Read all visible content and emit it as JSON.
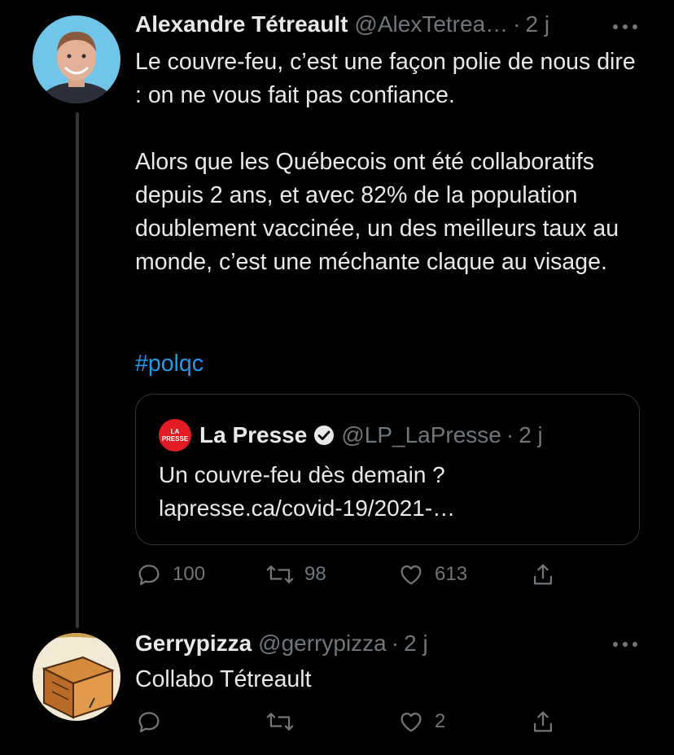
{
  "tweets": [
    {
      "author_name": "Alexandre Tétreault",
      "handle": "@AlexTetrea…",
      "dot": "·",
      "time": "2 j",
      "text": "Le couvre-feu, c’est une façon polie de nous dire : on ne vous fait pas confiance.\n\nAlors que les Québecois ont été collaboratifs depuis 2 ans, et avec 82% de la population doublement vaccinée, un des meilleurs taux au monde, c’est une méchante claque au visage.",
      "hashtag": "#polqc",
      "quote": {
        "logo_text_top": "LA",
        "logo_text_bottom": "PRESSE",
        "author_name": "La Presse",
        "handle": "@LP_LaPresse",
        "dot": "·",
        "time": "2 j",
        "text_line1": "Un couvre-feu dès demain ?",
        "text_line2": "lapresse.ca/covid-19/2021-…"
      },
      "actions": {
        "replies": "100",
        "retweets": "98",
        "likes": "613"
      }
    },
    {
      "author_name": "Gerrypizza",
      "handle": "@gerrypizza",
      "dot": "·",
      "time": "2 j",
      "text": "Collabo Tétreault",
      "actions": {
        "replies": "",
        "retweets": "",
        "likes": "2"
      }
    }
  ],
  "colors": {
    "background": "#000000",
    "text": "#e7e9ea",
    "muted": "#71767b",
    "link": "#1d9bf0",
    "border": "#333639",
    "lapresse_red": "#e31b23"
  },
  "icons": [
    "more-icon",
    "reply-icon",
    "retweet-icon",
    "like-icon",
    "share-icon",
    "verified-icon"
  ]
}
